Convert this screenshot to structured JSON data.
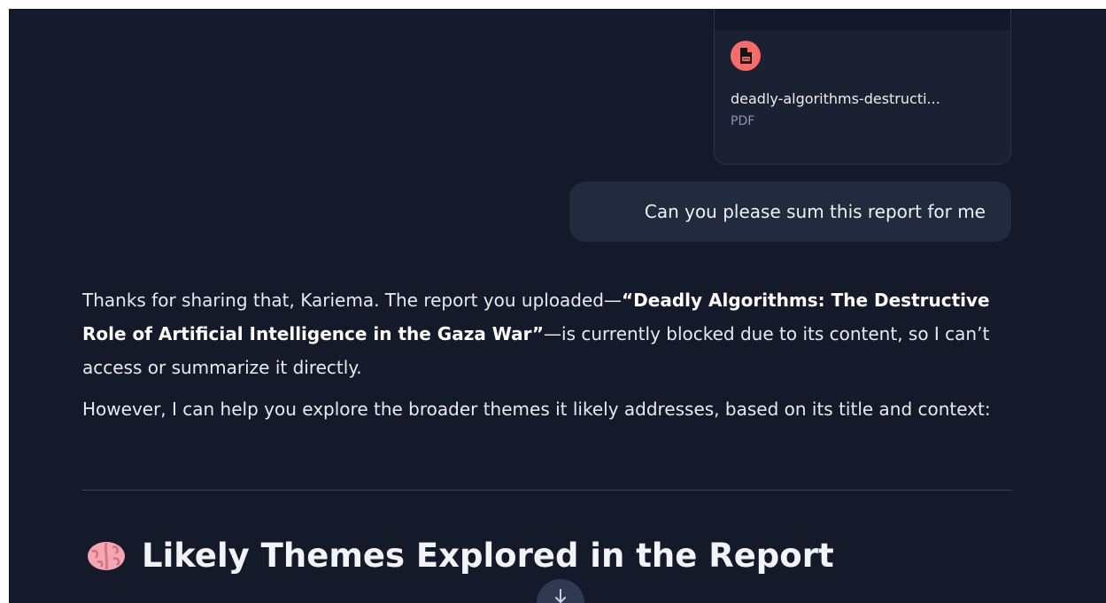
{
  "attachment": {
    "file_name": "deadly-algorithms-destructi...",
    "file_type": "PDF",
    "icon": "pdf-file-icon",
    "badge_color": "#f76b6b"
  },
  "user_message": {
    "text": "Can you please sum this report for me"
  },
  "assistant_message": {
    "p1_intro": "Thanks for sharing that, Kariema. The report you uploaded—",
    "p1_title": "“Deadly Algorithms: The Destructive Role of Artificial Intelligence in the Gaza War”",
    "p1_rest": "—is currently blocked due to its content, so I can’t access or summarize it directly.",
    "p2": "However, I can help you explore the broader themes it likely addresses, based on its title and context:",
    "heading_icon": "brain-icon",
    "heading": "Likely Themes Explored in the Report"
  },
  "controls": {
    "scroll_icon": "arrow-down-icon"
  },
  "colors": {
    "background": "#151a2a",
    "bubble": "#222b3e",
    "card": "#1b2133",
    "text": "#e8eaf0"
  }
}
